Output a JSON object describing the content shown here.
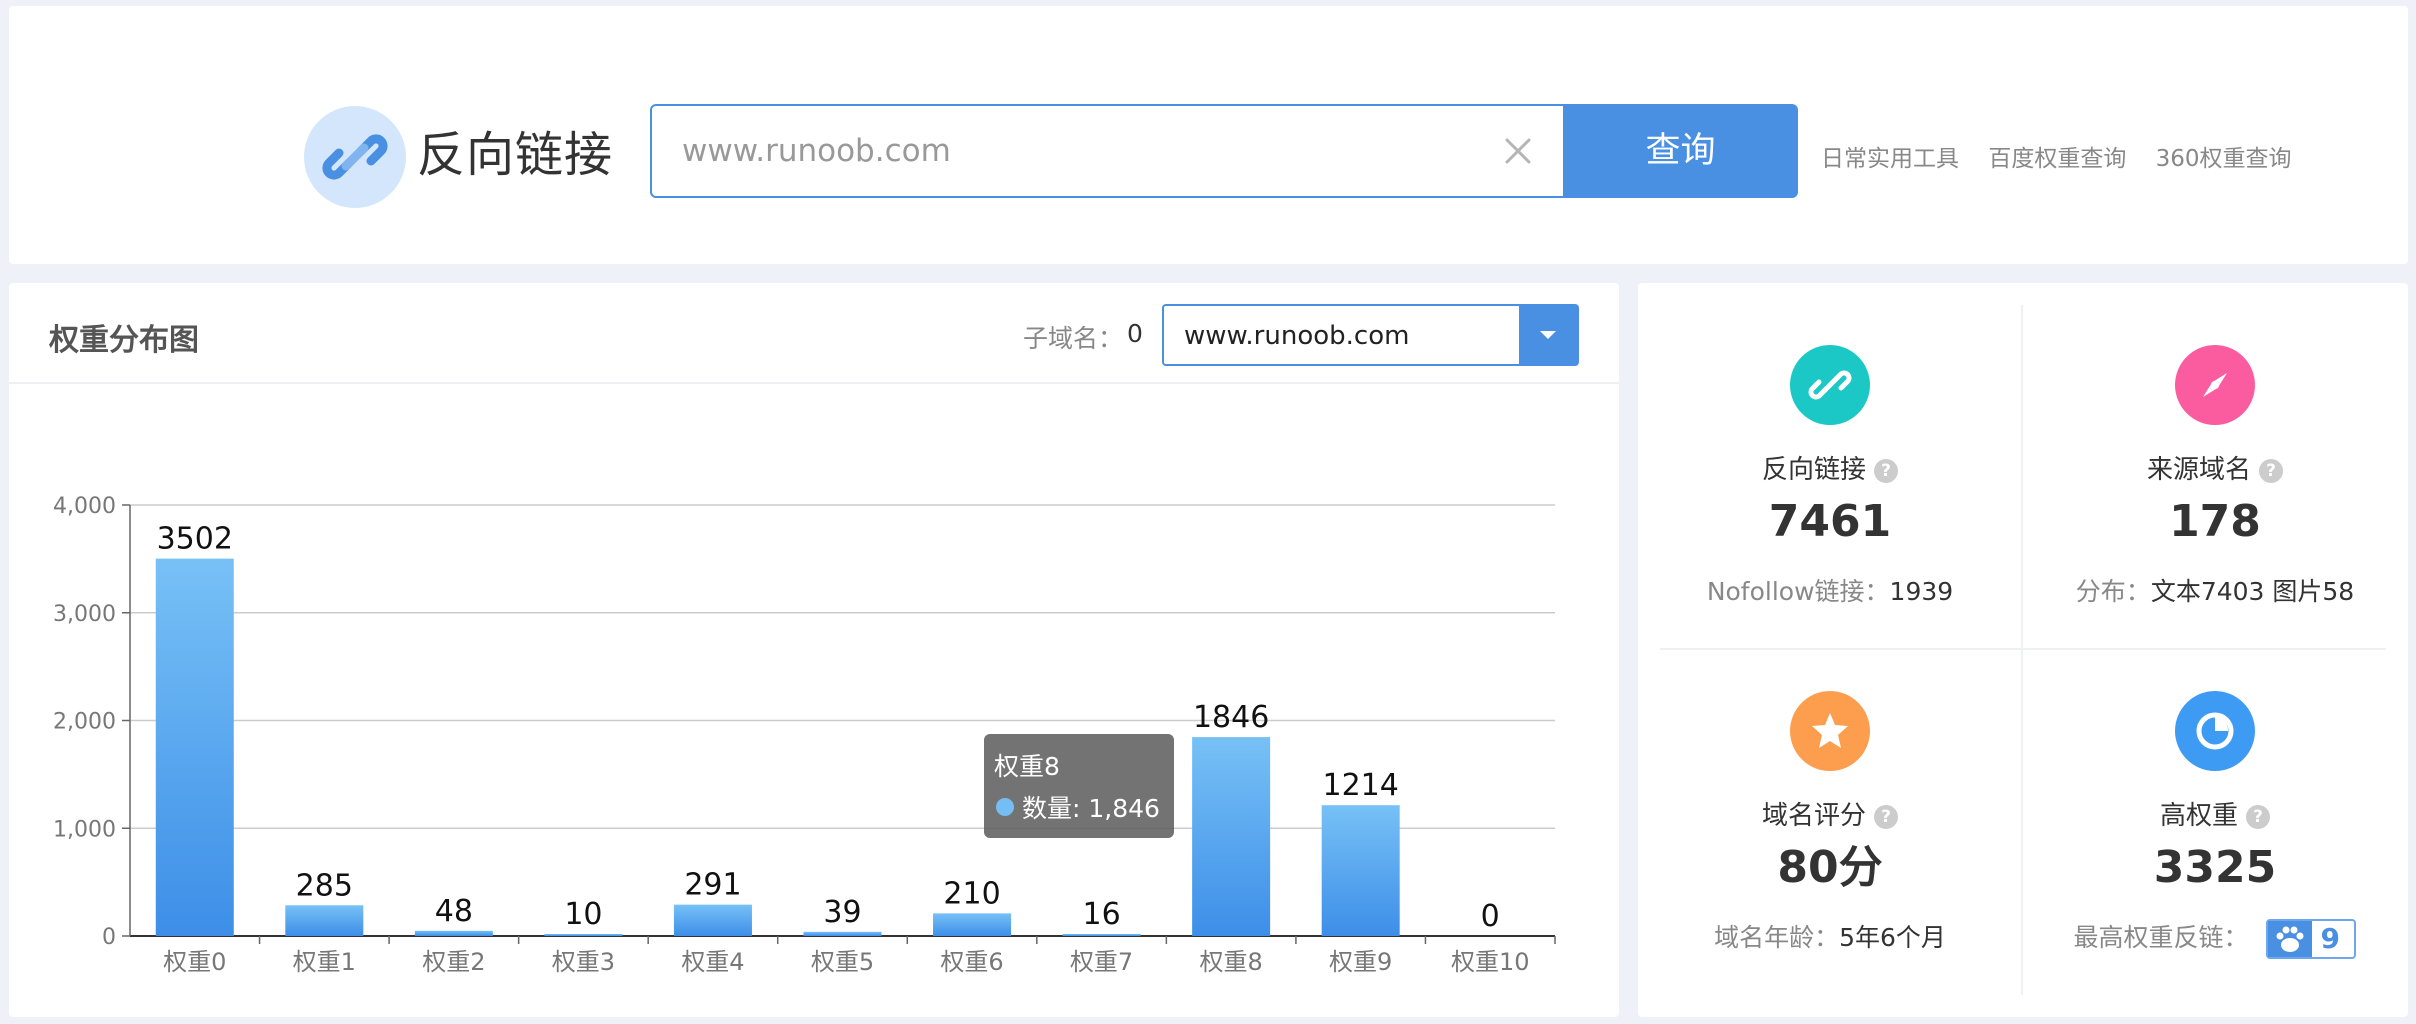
{
  "header": {
    "title": "反向链接",
    "search_placeholder": "www.runoob.com",
    "search_button": "查询",
    "links": [
      "日常实用工具",
      "百度权重查询",
      "360权重查询"
    ]
  },
  "chart_panel": {
    "title": "权重分布图",
    "subdomain_label": "子域名：",
    "subdomain_count": "0",
    "selected_domain": "www.runoob.com",
    "tooltip": {
      "title": "权重8",
      "label": "数量: 1,846"
    }
  },
  "chart_data": {
    "type": "bar",
    "categories": [
      "权重0",
      "权重1",
      "权重2",
      "权重3",
      "权重4",
      "权重5",
      "权重6",
      "权重7",
      "权重8",
      "权重9",
      "权重10"
    ],
    "values": [
      3502,
      285,
      48,
      10,
      291,
      39,
      210,
      16,
      1846,
      1214,
      0
    ],
    "value_labels": [
      "3502",
      "285",
      "48",
      "10",
      "291",
      "39",
      "210",
      "16",
      "1846",
      "1214",
      "0"
    ],
    "y_ticks": [
      "0",
      "1,000",
      "2,000",
      "3,000",
      "4,000"
    ],
    "y_tick_values": [
      0,
      1000,
      2000,
      3000,
      4000
    ],
    "ylim": [
      0,
      4000
    ],
    "grid": true,
    "bar_color_top": "#77c1f6",
    "bar_color_bottom": "#3d8ee8"
  },
  "stats": {
    "backlinks": {
      "label": "反向链接",
      "value": "7461",
      "foot_key": "Nofollow链接：",
      "foot_val": "1939",
      "color": "#1bc8c6"
    },
    "source_domains": {
      "label": "来源域名",
      "value": "178",
      "foot_key": "分布：",
      "foot_val": "文本7403 图片58",
      "color": "#fb5c9f"
    },
    "domain_score": {
      "label": "域名评分",
      "value": "80分",
      "foot_key": "域名年龄：",
      "foot_val": "5年6个月",
      "color": "#fd9e4f"
    },
    "high_weight": {
      "label": "高权重",
      "value": "3325",
      "foot_key": "最高权重反链：",
      "badge_value": "9",
      "color": "#3d9bf3"
    }
  },
  "icons": {
    "logo": "link-icon",
    "clear": "close-icon",
    "help": "question-icon",
    "baidu": "baidu-paw-icon"
  }
}
